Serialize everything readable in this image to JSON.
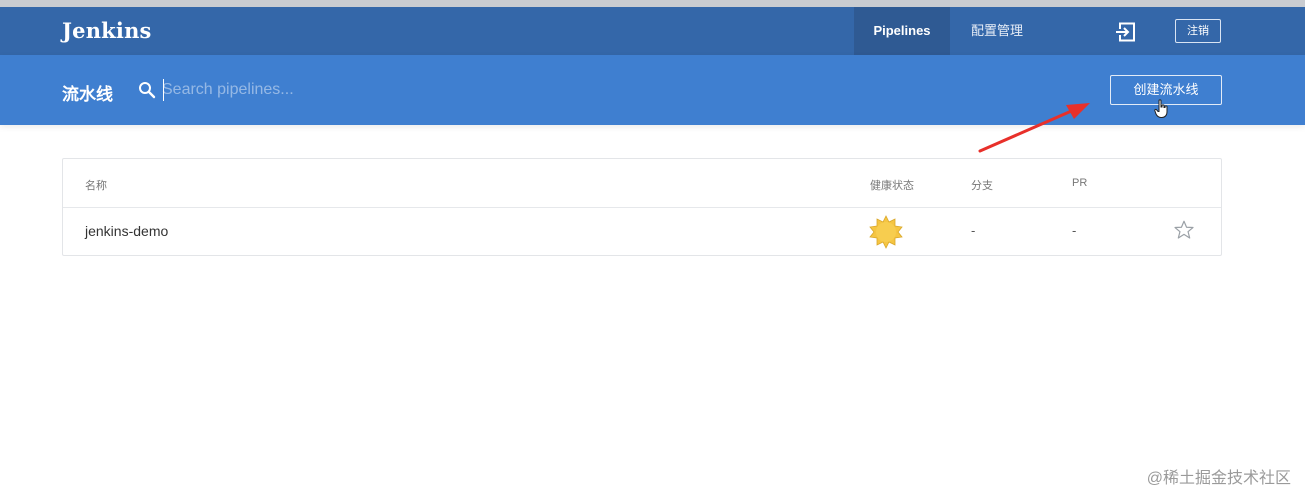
{
  "header": {
    "logo": "Jenkins",
    "tabs": [
      {
        "label": "Pipelines",
        "active": true
      },
      {
        "label": "配置管理",
        "active": false
      }
    ],
    "logout_label": "注销",
    "color": "#3467a9"
  },
  "subheader": {
    "title": "流水线",
    "search": {
      "placeholder": "Search pipelines...",
      "value": ""
    },
    "create_button": "创建流水线",
    "color": "#3f7fd0"
  },
  "table": {
    "columns": [
      "名称",
      "健康状态",
      "分支",
      "PR"
    ],
    "rows": [
      {
        "name": "jenkins-demo",
        "health_icon": "sunny-icon",
        "branches": "-",
        "pr": "-",
        "favorite": false
      }
    ]
  },
  "annotation": {
    "arrow_color": "#e8302a"
  },
  "watermark": "@稀土掘金技术社区"
}
